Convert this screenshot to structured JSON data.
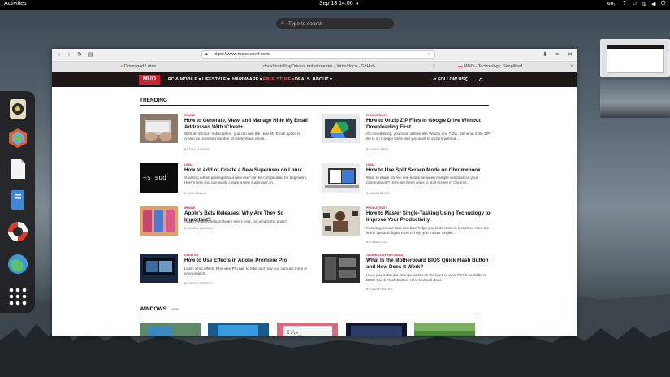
{
  "topbar": {
    "activities": "Activities",
    "clock": "Sep 13  14:06",
    "lang": "en₁",
    "icons": [
      "question-icon",
      "accessibility-icon",
      "network-icon",
      "volume-icon",
      "power-icon"
    ]
  },
  "search": {
    "placeholder": "Type to search"
  },
  "dock": {
    "apps": [
      "rhythmbox-icon",
      "software-icon",
      "text-editor-icon",
      "files-icon",
      "help-icon",
      "browser-icon",
      "show-apps-icon"
    ]
  },
  "browser": {
    "url": "https://www.makeuseof.com/",
    "tabs": [
      "Download Lutris",
      "docs/InstallingDrivers.md at master · lutris/docs · GitHub",
      "MUO - Technology, Simplified."
    ]
  },
  "site": {
    "logo": "MUO",
    "nav": [
      "PC & MOBILE ▾",
      "LIFESTYLE ▾",
      "HARDWARE ▾",
      "FREE STUFF ▾",
      "DEALS",
      "ABOUT ▾"
    ],
    "follow": "FOLLOW US",
    "trending_title": "TRENDING",
    "windows_title": "WINDOWS",
    "windows_more": "MORE",
    "articles": [
      {
        "category": "iPhone",
        "title": "How to Generate, View, and Manage Hide My Email Addresses With iCloud+",
        "excerpt": "With an iCloud+ subscription, you can use the Hide My Email option to create an unlimited number of anonymous email...",
        "author": "BY TOM TSANDEK"
      },
      {
        "category": "Productivity",
        "title": "How to Unzip ZIP Files in Google Drive Without Downloading First",
        "excerpt": "On the desktop, you have utilities like WinZip and 7-Zip. But what if the ZIP file is on Google Drive and you want to unzip it without...",
        "author": "BY SARAT BABU"
      },
      {
        "category": "Linux",
        "title": "How to Add or Create a New Superuser on Linux",
        "excerpt": "Granting admin privileges to a new user can be complicated for beginners. Here's how you can easily create a new superuser on...",
        "author": "BY NIKI BHALLA"
      },
      {
        "category": "Linux",
        "title": "How to Use Split Screen Mode on Chromebook",
        "excerpt": "Want to share screen real estate between multiple windows on your Chromebook? Here are three ways to split screen in Chrome...",
        "author": "BY DAVID BEGRY"
      },
      {
        "category": "iPhone",
        "title": "Apple's Beta Releases: Why Are They So Important?",
        "excerpt": "Apple releases beta software every year, but what's the point?",
        "author": "BY DANNY MANNICA"
      },
      {
        "category": "Productivity",
        "title": "How to Master Single-Tasking Using Technology to Improve Your Productivity",
        "excerpt": "Focusing on one task at a time helps you to do more in less time. Here are some tips and digital tools to help you master single-...",
        "author": "BY LAMES LUO"
      },
      {
        "category": "Creative",
        "title": "How to Use Effects in Adobe Premiere Pro",
        "excerpt": "Learn what effects Premiere Pro has to offer and how you can use them in your projects.",
        "author": "BY DENIS GABRIELS"
      },
      {
        "category": "Technology Explained",
        "title": "What Is the Motherboard BIOS Quick Flash Button and How Does It Work?",
        "excerpt": "Have you noticed a strange button on the back of your PC? It could be a BIOS Quick Flash Button. Here's what it does.",
        "author": "BY GAVIN PHILLIPS"
      }
    ]
  },
  "colors": {
    "brand": "#d4232f",
    "nav_bg": "#1f1616"
  }
}
